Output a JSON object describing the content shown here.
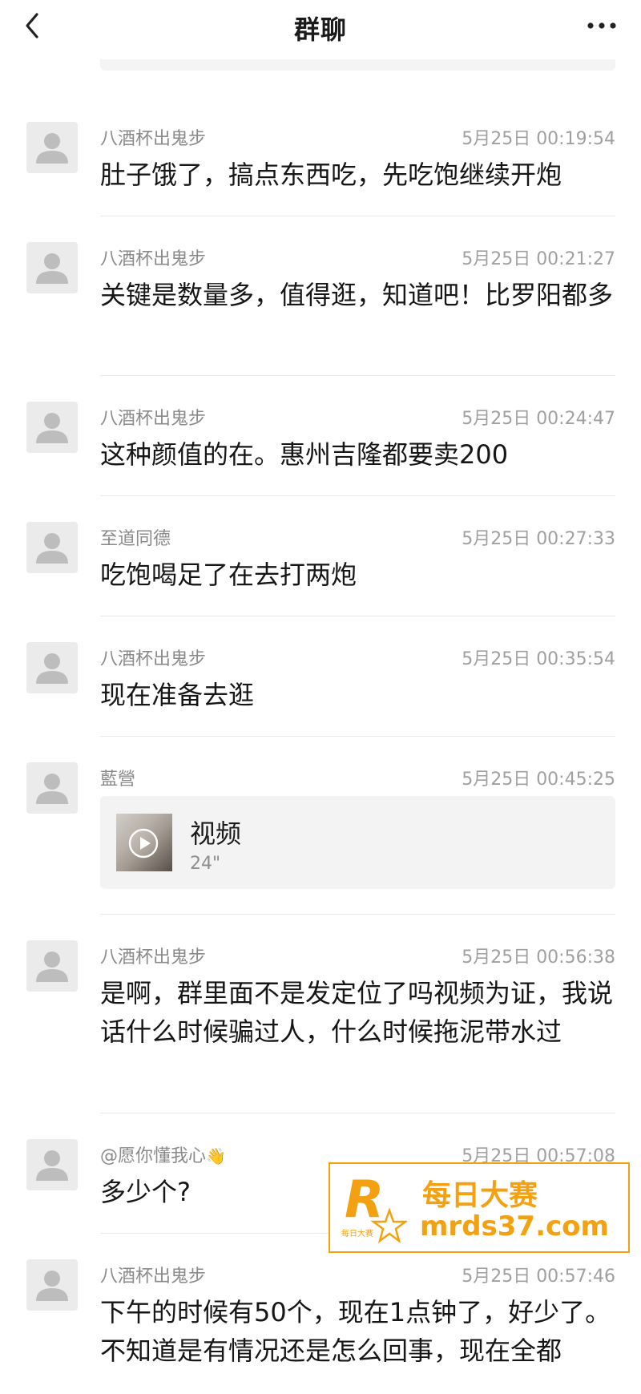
{
  "header": {
    "title": "群聊",
    "back_icon": "chevron-left-icon",
    "more_icon": "more-dots-icon"
  },
  "messages": [
    {
      "sender": "八酒杯出鬼步",
      "time": "5月25日 00:19:54",
      "text": "肚子饿了，搞点东西吃，先吃饱继续开炮"
    },
    {
      "sender": "八酒杯出鬼步",
      "time": "5月25日 00:21:27",
      "text": "关键是数量多，值得逛，知道吧！比罗阳都多"
    },
    {
      "sender": "八酒杯出鬼步",
      "time": "5月25日 00:24:47",
      "text": "这种颜值的在。惠州吉隆都要卖200"
    },
    {
      "sender": "至道同德",
      "time": "5月25日 00:27:33",
      "text": "吃饱喝足了在去打两炮"
    },
    {
      "sender": "八酒杯出鬼步",
      "time": "5月25日 00:35:54",
      "text": "现在准备去逛"
    },
    {
      "sender": "藍營",
      "time": "5月25日 00:45:25",
      "video": {
        "title": "视频",
        "duration": "24\""
      }
    },
    {
      "sender": "八酒杯出鬼步",
      "time": "5月25日 00:56:38",
      "text": "是啊，群里面不是发定位了吗视频为证，我说话什么时候骗过人，什么时候拖泥带水过"
    },
    {
      "sender": "@愿你懂我心",
      "sender_emoji": "👋",
      "time": "5月25日 00:57:08",
      "text": "多少个?"
    },
    {
      "sender": "八酒杯出鬼步",
      "time": "5月25日 00:57:46",
      "text": "下午的时候有50个，现在1点钟了，好少了。不知道是有情况还是怎么回事，现在全都"
    }
  ],
  "watermark": {
    "logo_letter": "R",
    "logo_small": "每日大赛",
    "name": "每日大赛",
    "url": "mrds37.com",
    "color": "#f3a011"
  },
  "colors": {
    "background": "#ffffff",
    "sender": "#8a8a8a",
    "time": "#a0a0a0",
    "divider": "#e8e8e8"
  }
}
